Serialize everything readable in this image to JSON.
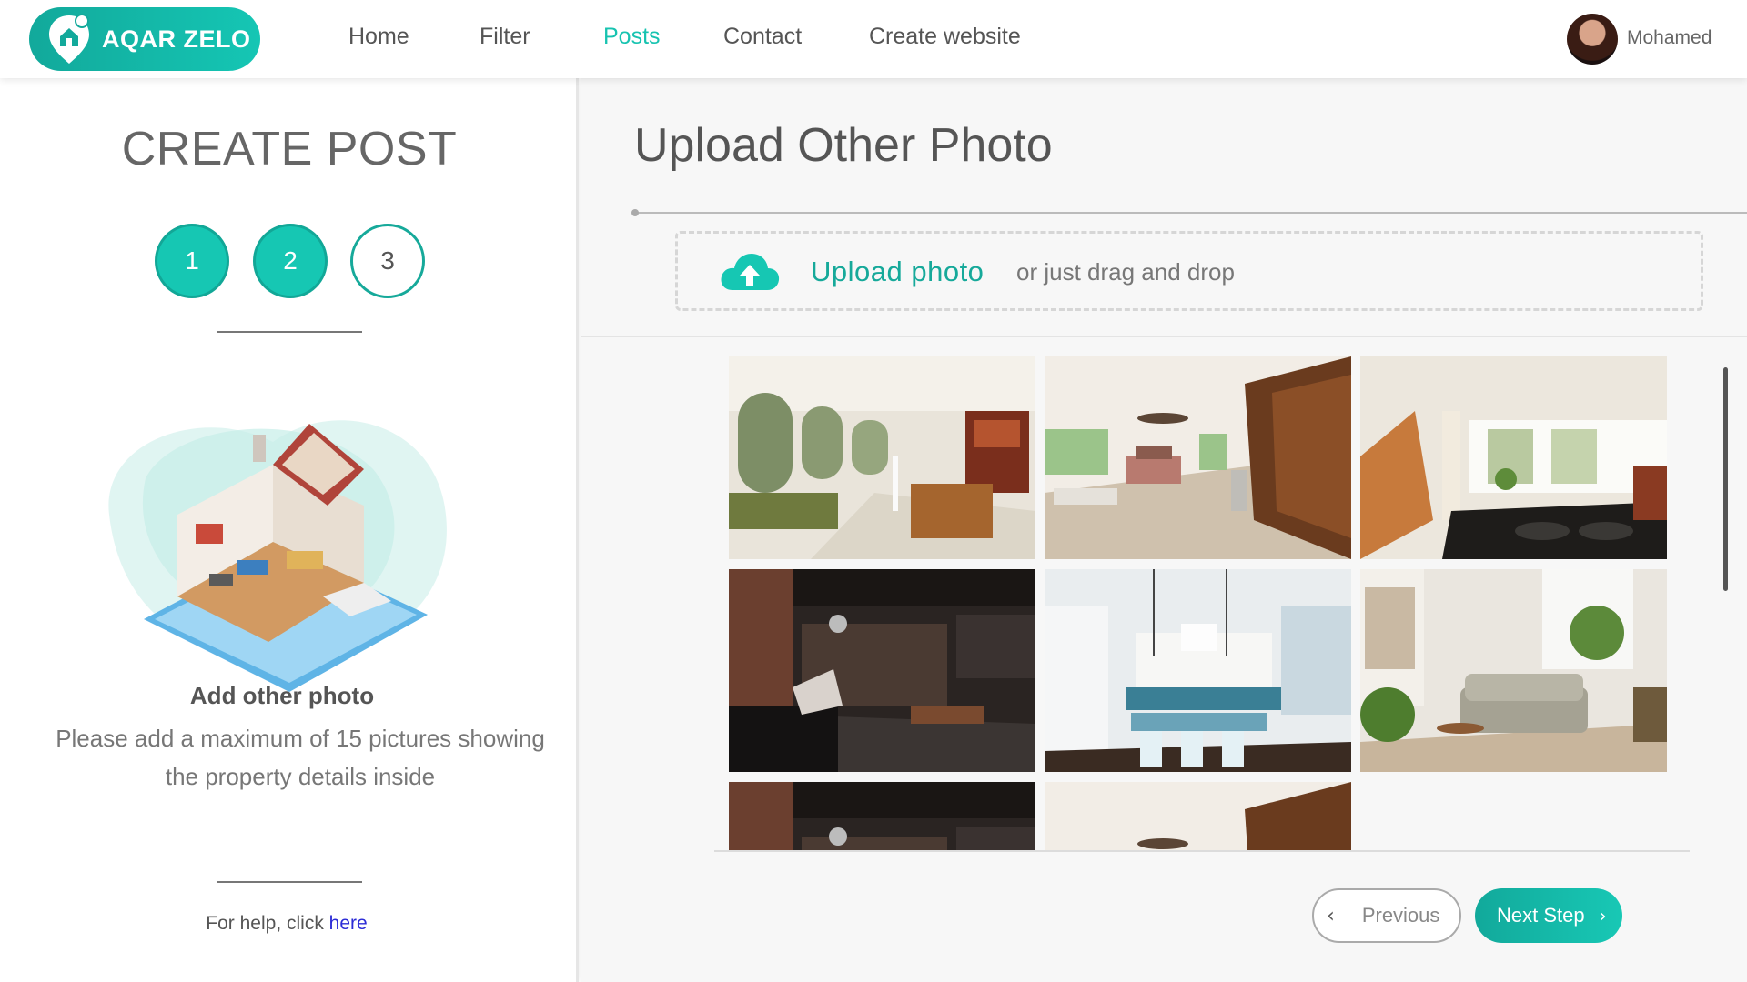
{
  "navbar": {
    "brand": "AQAR ZELO",
    "links": [
      "Home",
      "Filter",
      "Posts",
      "Contact",
      "Create website"
    ],
    "active_link": "Posts",
    "user_name": "Mohamed"
  },
  "sidebar": {
    "title": "CREATE POST",
    "steps": [
      "1",
      "2",
      "3"
    ],
    "current_step": 3,
    "add_title": "Add other photo",
    "add_description": "Please add a maximum of 15 pictures showing the property details inside",
    "help_text": "For help, click",
    "help_link": "here"
  },
  "main": {
    "title": "Upload Other Photo",
    "upload_link": "Upload photo",
    "drag_text": "or just drag and drop",
    "photos": [
      "living-room-with-arched-windows",
      "bedroom-with-wood-wall",
      "kitchen-with-gas-stovetop",
      "loft-with-brick-wall",
      "white-kitchen-with-island",
      "living-room-with-plants",
      "loft-with-brick-wall",
      "bedroom-with-wood-wall"
    ],
    "previous_label": "Previous",
    "next_label": "Next Step"
  },
  "colors": {
    "accent": "#16c7b3",
    "accent_dark": "#12a99b",
    "link": "#2b2bd6"
  }
}
